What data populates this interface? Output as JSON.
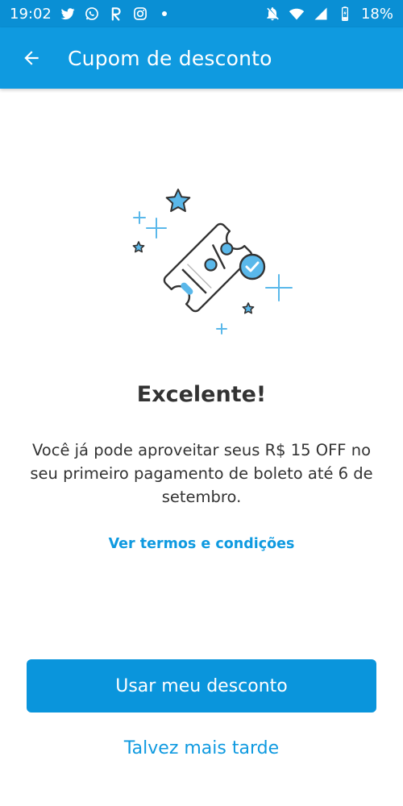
{
  "status_bar": {
    "time": "19:02",
    "battery_percent": "18%",
    "left_icons": [
      "twitter-icon",
      "whatsapp-icon",
      "r-app-icon",
      "instagram-icon",
      "notification-dot-icon"
    ],
    "right_icons": [
      "notifications-off-icon",
      "wifi-icon",
      "cell-signal-icon",
      "battery-icon"
    ]
  },
  "app_bar": {
    "title": "Cupom de desconto",
    "back_icon": "arrow-left-icon"
  },
  "content": {
    "illustration_icon": "discount-coupon-icon",
    "headline": "Excelente!",
    "message": "Você já pode aproveitar seus R$ 15 OFF no seu primeiro pagamento de boleto até 6 de setembro.",
    "terms_link": "Ver termos e condições"
  },
  "actions": {
    "primary_label": "Usar meu desconto",
    "secondary_label": "Talvez mais tarde"
  },
  "colors": {
    "primary": "#0f9ae0",
    "status_bar": "#0a8fd4",
    "text": "#333333",
    "accent_light": "#5ab8ea"
  }
}
